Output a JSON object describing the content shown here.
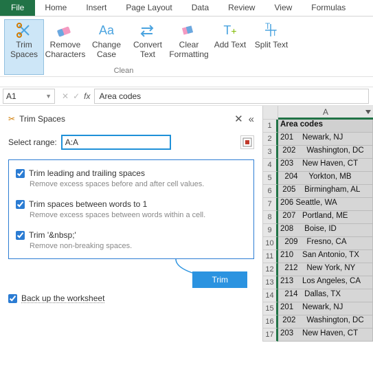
{
  "ribbon": {
    "tabs": {
      "file": "File",
      "home": "Home",
      "insert": "Insert",
      "page_layout": "Page Layout",
      "data": "Data",
      "review": "Review",
      "view": "View",
      "formulas": "Formulas"
    },
    "buttons": {
      "trim": "Trim Spaces",
      "remove": "Remove Characters",
      "change": "Change Case",
      "convert": "Convert Text",
      "clear": "Clear Formatting",
      "add": "Add Text",
      "split": "Split Text"
    },
    "group": "Clean"
  },
  "namebox": "A1",
  "formula_bar": "Area codes",
  "pane": {
    "title": "Trim Spaces",
    "select_label": "Select range:",
    "range": "A:A",
    "opts": [
      {
        "h": "Trim leading and trailing spaces",
        "d": "Remove excess spaces before and after cell values."
      },
      {
        "h": "Trim spaces between words to 1",
        "d": "Remove excess spaces between words within a cell."
      },
      {
        "h": "Trim '&nbsp;'",
        "d": "Remove non-breaking spaces."
      }
    ],
    "backup": "Back up the worksheet",
    "trim_btn": "Trim"
  },
  "sheet": {
    "col": "A",
    "rows": [
      "Area codes",
      "201    Newark, NJ",
      " 202     Washington, DC",
      "203    New Haven, CT",
      "  204     Yorkton, MB",
      " 205    Birmingham, AL",
      "206 Seattle, WA",
      " 207   Portland, ME",
      "208     Boise, ID",
      "  209    Fresno, CA",
      "210    San Antonio, TX",
      "  212    New York, NY",
      "213    Los Angeles, CA",
      "  214   Dallas, TX",
      "201    Newark, NJ",
      " 202     Washington, DC",
      "203    New Haven, CT"
    ]
  }
}
